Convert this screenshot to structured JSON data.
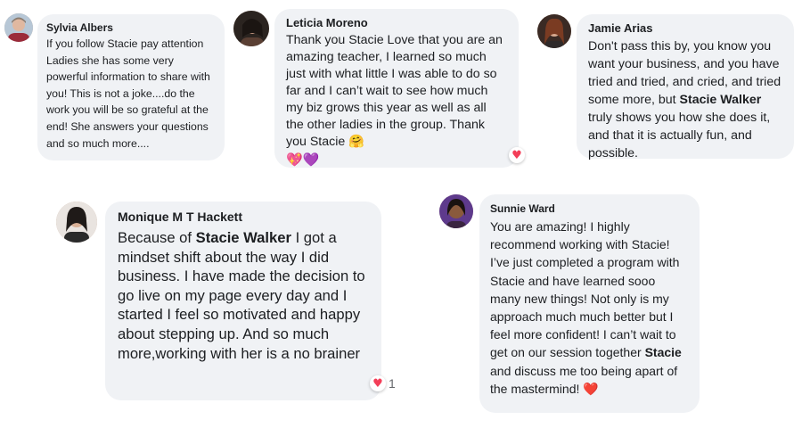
{
  "comments": [
    {
      "author": "Sylvia Albers",
      "text": "If you follow Stacie pay attention Ladies she has some very powerful information to share with you!  This is not a joke....do the work you will be so grateful at the end!  She answers your questions and so much more...."
    },
    {
      "author": "Leticia Moreno",
      "text": "Thank you Stacie Love that you are an amazing teacher, I learned so much just with what little I was able to do so far and I can’t wait to see how much my biz grows this year as well as all the other ladies in the group. Thank you Stacie",
      "emoji_inline": "🤗",
      "emoji_line": "💖💜",
      "reaction_icon": "heart-icon"
    },
    {
      "author": "Jamie Arias",
      "text_before": "Don't pass this by, you know you want your business, and you have tried and tried, and cried, and tried some more, but ",
      "mention": "Stacie Walker",
      "text_after": " truly shows you how she does it, and that it is actually fun, and possible."
    },
    {
      "author": "Monique M T Hackett",
      "text_before": "Because of ",
      "mention": "Stacie Walker",
      "text_after": " I got a mindset shift about the way I did business. I have made the decision to go live on my page every day and I started I feel so motivated and happy about stepping up. And so much more,working with her is a no brainer",
      "reaction_icon": "heart-icon",
      "reaction_count": "1"
    },
    {
      "author": "Sunnie Ward",
      "text_before": "You are amazing! I highly recommend working with Stacie! I’ve just completed a program with Stacie and have learned sooo many new things! Not only is my approach much much better but I feel more confident! I can’t wait to get on our session together ",
      "mention": "Stacie",
      "text_after": " and discuss me too being apart of the mastermind!",
      "emoji_end": "❤️"
    }
  ],
  "colors": {
    "bubble": "#f0f2f5",
    "heart": "#f33e58",
    "text": "#1c1e21"
  }
}
